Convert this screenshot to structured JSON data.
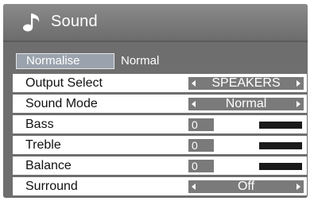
{
  "title": "Sound",
  "normalise": {
    "label": "Normalise",
    "value": "Normal"
  },
  "rows": [
    {
      "label": "Output Select",
      "type": "select",
      "value": "SPEAKERS"
    },
    {
      "label": "Sound Mode",
      "type": "select",
      "value": "Normal"
    },
    {
      "label": "Bass",
      "type": "slider",
      "value": "0",
      "level": 0.5
    },
    {
      "label": "Treble",
      "type": "slider",
      "value": "0",
      "level": 0.5
    },
    {
      "label": "Balance",
      "type": "slider",
      "value": "0",
      "level": 0.5
    },
    {
      "label": "Surround",
      "type": "select",
      "value": "Off"
    }
  ],
  "icons": {
    "title": "music-note-icon",
    "left_arrow": "left-arrow-icon",
    "right_arrow": "right-arrow-icon"
  },
  "colors": {
    "panel": "#6e6e6e",
    "title_bar": "#7c7c7c",
    "highlight": "#9aa3ad",
    "selector": "#7a7a7a"
  }
}
